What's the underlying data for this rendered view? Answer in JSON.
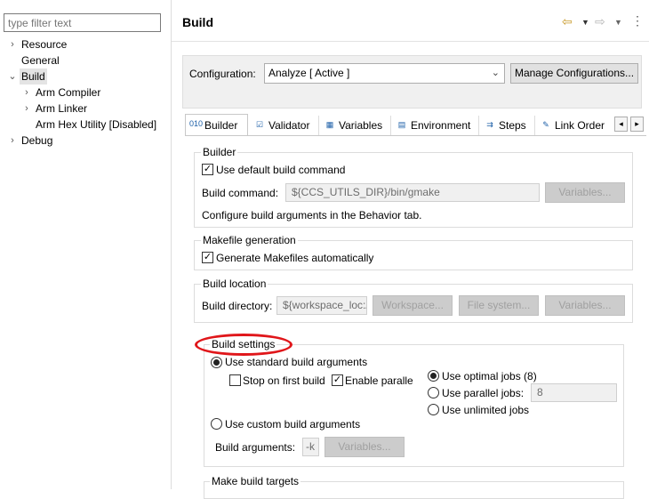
{
  "filter": {
    "placeholder": "type filter text"
  },
  "tree": [
    {
      "label": "Resource",
      "twisty": "›"
    },
    {
      "label": "General",
      "twisty": ""
    },
    {
      "label": "Build",
      "twisty": "⌄"
    },
    {
      "label": "Arm Compiler",
      "twisty": "›"
    },
    {
      "label": "Arm Linker",
      "twisty": "›"
    },
    {
      "label": "Arm Hex Utility  [Disabled]",
      "twisty": ""
    },
    {
      "label": "Debug",
      "twisty": "›"
    }
  ],
  "header": {
    "title": "Build"
  },
  "config": {
    "label": "Configuration:",
    "value": "Analyze  [ Active ]",
    "manage": "Manage Configurations..."
  },
  "tabs": [
    "Builder",
    "Validator",
    "Variables",
    "Environment",
    "Steps",
    "Link Order"
  ],
  "builder": {
    "group": "Builder",
    "use_default": "Use default build command",
    "cmd_label": "Build command:",
    "cmd_value": "${CCS_UTILS_DIR}/bin/gmake",
    "variables": "Variables...",
    "note": "Configure build arguments in the Behavior tab."
  },
  "makefile": {
    "group": "Makefile generation",
    "auto": "Generate Makefiles automatically"
  },
  "location": {
    "group": "Build location",
    "dir_label": "Build directory:",
    "dir_value": "${workspace_loc:/",
    "workspace": "Workspace...",
    "filesystem": "File system...",
    "variables": "Variables..."
  },
  "settings": {
    "group": "Build settings",
    "standard": "Use standard build arguments",
    "stop": "Stop on first build",
    "parallel": "Enable parallel build",
    "optimal": "Use optimal jobs (8)",
    "parallel_jobs": "Use parallel jobs:",
    "jobs_value": "8",
    "unlimited": "Use unlimited jobs",
    "custom": "Use custom build arguments",
    "args_label": "Build arguments:",
    "args_value": "-k",
    "variables": "Variables..."
  },
  "targets": {
    "group": "Make build targets"
  }
}
